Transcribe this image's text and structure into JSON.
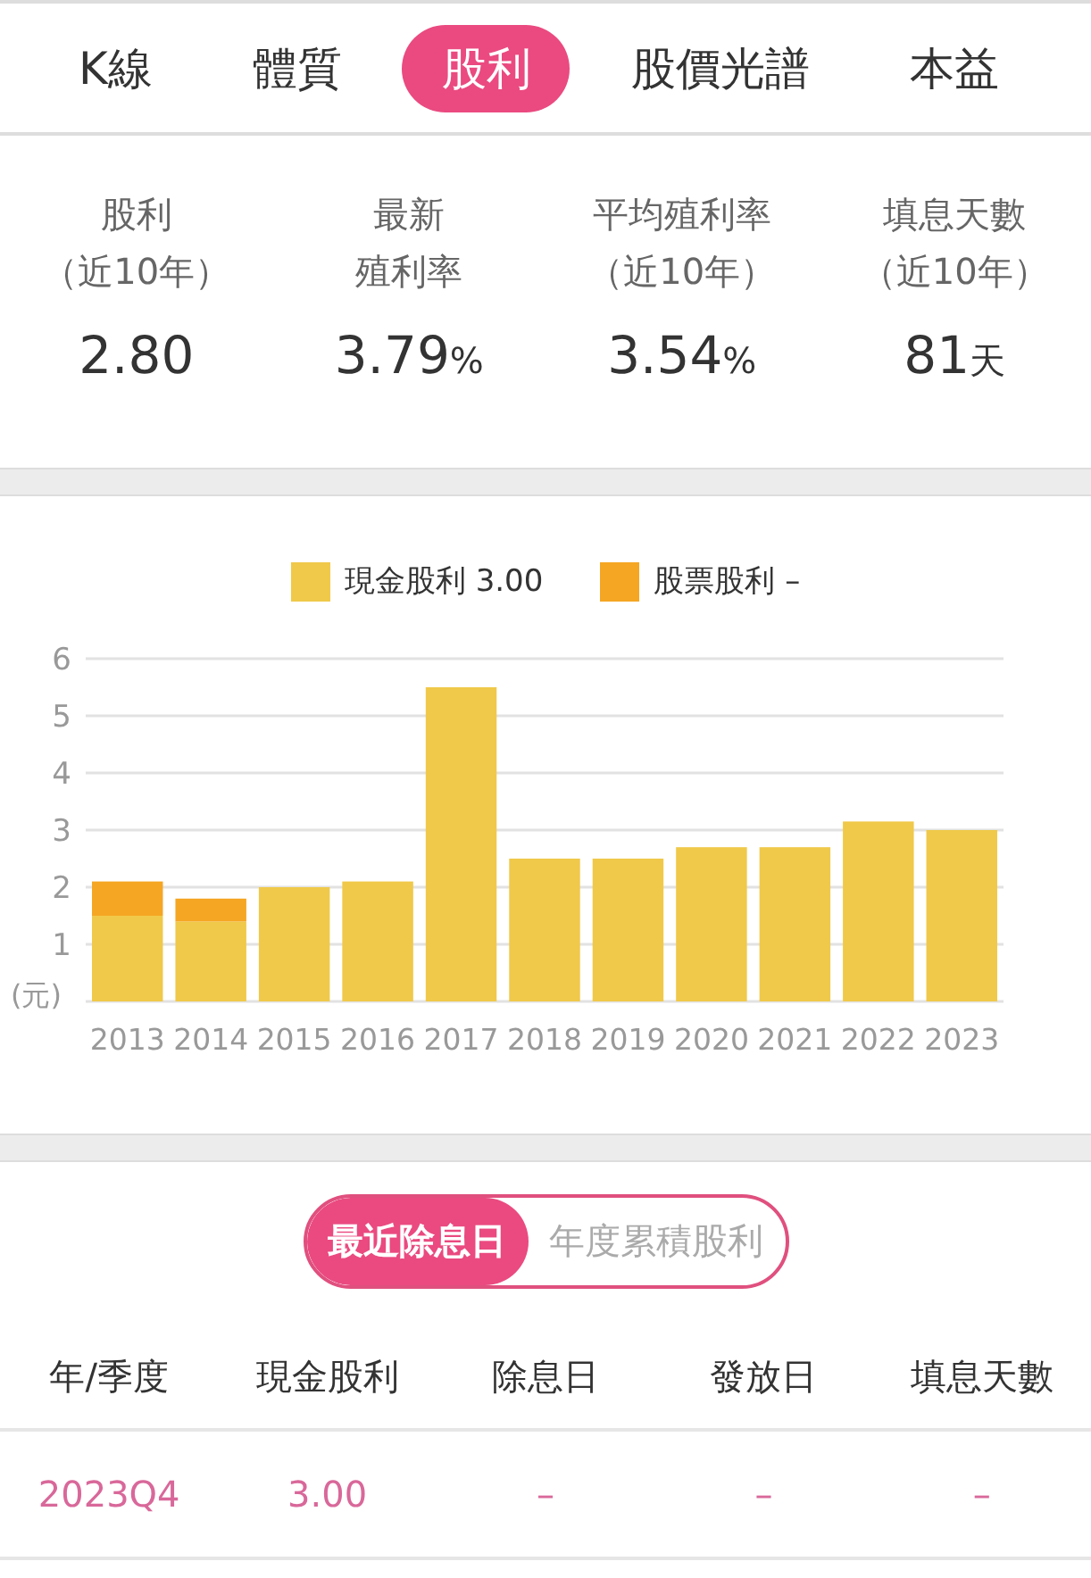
{
  "tabs": [
    {
      "label": "K線",
      "selected": false
    },
    {
      "label": "體質",
      "selected": false
    },
    {
      "label": "股利",
      "selected": true
    },
    {
      "label": "股價光譜",
      "selected": false
    },
    {
      "label": "本益",
      "selected": false
    }
  ],
  "stats": [
    {
      "label_lines": [
        "股利",
        "（近10年）"
      ],
      "value": "2.80"
    },
    {
      "label_lines": [
        "最新",
        "殖利率"
      ],
      "value": "3.79",
      "unit": "%"
    },
    {
      "label_lines": [
        "平均殖利率",
        "（近10年）"
      ],
      "value": "3.54",
      "unit": "%"
    },
    {
      "label_lines": [
        "填息天數",
        "（近10年）"
      ],
      "value": "81",
      "unit": "天"
    }
  ],
  "chart": {
    "legend": [
      {
        "value": "3.00"
      },
      {
        "value": "–"
      }
    ],
    "chart_data": {
      "type": "bar",
      "stacked": true,
      "grid": true,
      "ylabel": "(元)",
      "ylim": [
        0,
        6
      ],
      "yticks": [
        1,
        2,
        3,
        4,
        5,
        6
      ],
      "categories": [
        "2013",
        "2014",
        "2015",
        "2016",
        "2017",
        "2018",
        "2019",
        "2020",
        "2021",
        "2022",
        "2023"
      ],
      "series": [
        {
          "name": "現金股利",
          "color": "#f0c94a",
          "values": [
            1.5,
            1.4,
            2.0,
            2.1,
            5.5,
            2.5,
            2.5,
            2.7,
            2.7,
            3.15,
            3.0
          ]
        },
        {
          "name": "股票股利",
          "color": "#f5a623",
          "values": [
            0.6,
            0.4,
            null,
            null,
            null,
            null,
            null,
            null,
            null,
            null,
            null
          ]
        }
      ]
    }
  },
  "toggle": [
    {
      "label": "最近除息日",
      "selected": true
    },
    {
      "label": "年度累積股利",
      "selected": false
    }
  ],
  "table": {
    "columns": [
      "年/季度",
      "現金股利",
      "除息日",
      "發放日",
      "填息天數"
    ],
    "rows": [
      [
        "2023Q4",
        "3.00",
        "–",
        "–",
        "–"
      ]
    ]
  }
}
